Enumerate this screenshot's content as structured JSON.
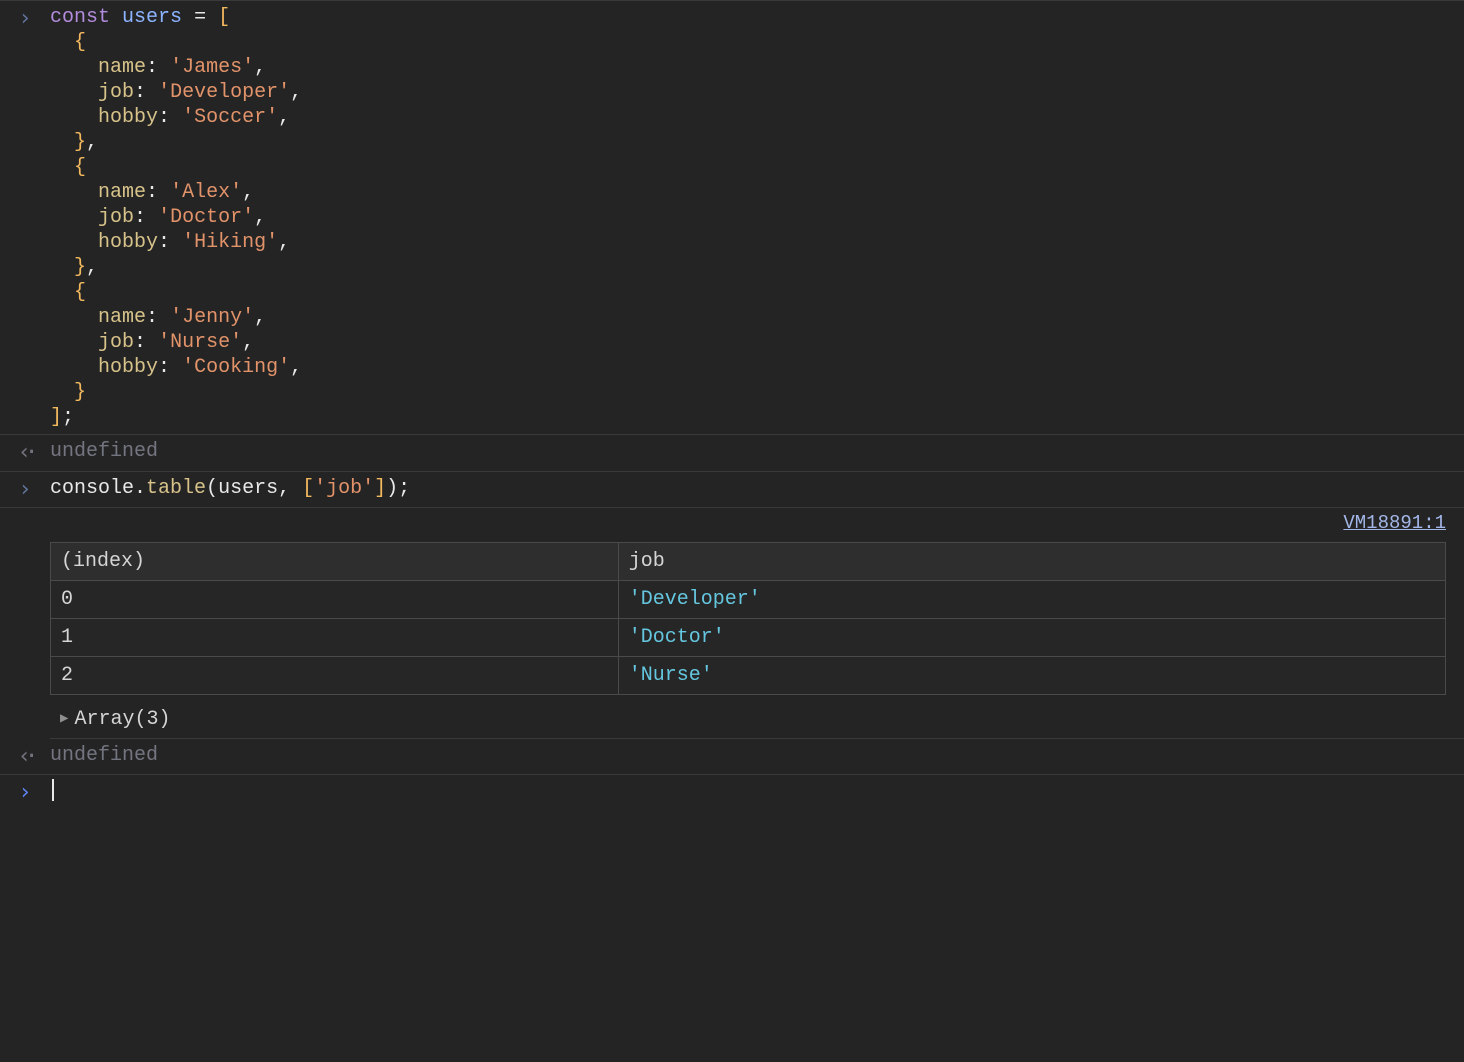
{
  "entries": [
    {
      "type": "input",
      "code": {
        "keyword": "const",
        "varname": "users",
        "objects": [
          {
            "name": "James",
            "job": "Developer",
            "hobby": "Soccer"
          },
          {
            "name": "Alex",
            "job": "Doctor",
            "hobby": "Hiking"
          },
          {
            "name": "Jenny",
            "job": "Nurse",
            "hobby": "Cooking"
          }
        ],
        "prop_keys": [
          "name",
          "job",
          "hobby"
        ]
      }
    },
    {
      "type": "output",
      "text_undefined": "undefined"
    },
    {
      "type": "input",
      "code2": {
        "obj": "console",
        "method": "table",
        "arg_var": "users",
        "arg_col": "'job'"
      }
    },
    {
      "type": "table",
      "source_link": "VM18891:1",
      "headers": [
        "(index)",
        "job"
      ],
      "rows": [
        {
          "idx": "0",
          "val": "'Developer'"
        },
        {
          "idx": "1",
          "val": "'Doctor'"
        },
        {
          "idx": "2",
          "val": "'Nurse'"
        }
      ],
      "array_summary": "Array(3)"
    },
    {
      "type": "output",
      "text_undefined": "undefined"
    },
    {
      "type": "prompt"
    }
  ],
  "chart_data": {
    "type": "table",
    "title": "",
    "columns": [
      "(index)",
      "job"
    ],
    "rows": [
      [
        0,
        "Developer"
      ],
      [
        1,
        "Doctor"
      ],
      [
        2,
        "Nurse"
      ]
    ]
  }
}
